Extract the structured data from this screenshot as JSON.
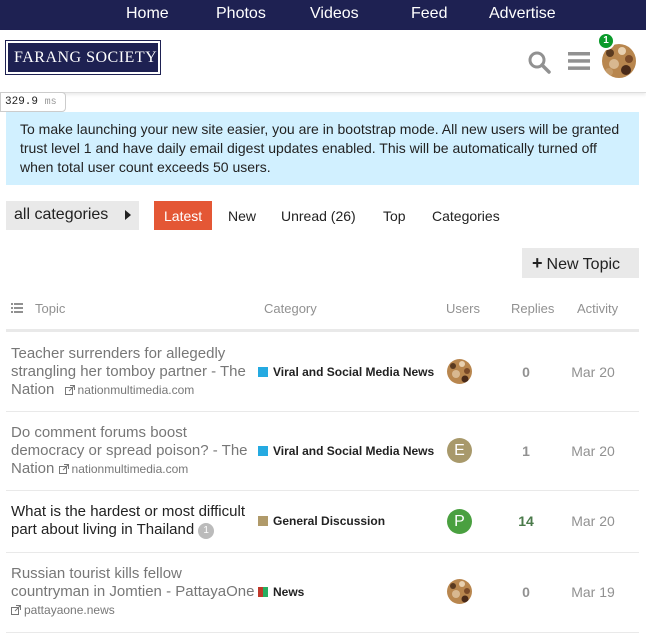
{
  "topnav": [
    "Home",
    "Photos",
    "Videos",
    "Feed",
    "Advertise"
  ],
  "logo": "FARANG SOCIETY",
  "timer": {
    "value": "329.9",
    "unit": "ms"
  },
  "notifications": "1",
  "banner": "To make launching your new site easier, you are in bootstrap mode. All new users will be granted trust level 1 and have daily email digest updates enabled. This will be automatically turned off when total user count exceeds 50 users.",
  "category_dropdown": "all categories",
  "nav": [
    "Latest",
    "New",
    "Unread (26)",
    "Top",
    "Categories"
  ],
  "new_topic": "New Topic",
  "columns": {
    "topic": "Topic",
    "category": "Category",
    "users": "Users",
    "replies": "Replies",
    "activity": "Activity"
  },
  "colors": {
    "accent": "#e45735",
    "header": "#1e2152",
    "banner": "#d1f0ff"
  },
  "topics": [
    {
      "title": "Teacher surrenders for allegedly strangling her tomboy partner - The Nation",
      "domain": "nationmultimedia.com",
      "category": "Viral and Social Media News",
      "cat_color": "#25aae1",
      "user": "avatar",
      "replies": "0",
      "activity": "Mar 20"
    },
    {
      "title": "Do comment forums boost democracy or spread poison? - The Nation",
      "domain": "nationmultimedia.com",
      "category": "Viral and Social Media News",
      "cat_color": "#25aae1",
      "user": "E",
      "user_color": "#a8996b",
      "replies": "1",
      "activity": "Mar 20"
    },
    {
      "title": "What is the hardest or most difficult part about living in Thailand",
      "badge": "1",
      "category": "General Discussion",
      "cat_color": "#b09a6a",
      "user": "P",
      "user_color": "#4aa040",
      "replies": "14",
      "activity": "Mar 20"
    },
    {
      "title": "Russian tourist kills fellow countryman in Jomtien - PattayaOne",
      "domain": "pattayaone.news",
      "category": "News",
      "cat_color": "#c0392b",
      "user": "avatar",
      "replies": "0",
      "activity": "Mar 19"
    }
  ]
}
